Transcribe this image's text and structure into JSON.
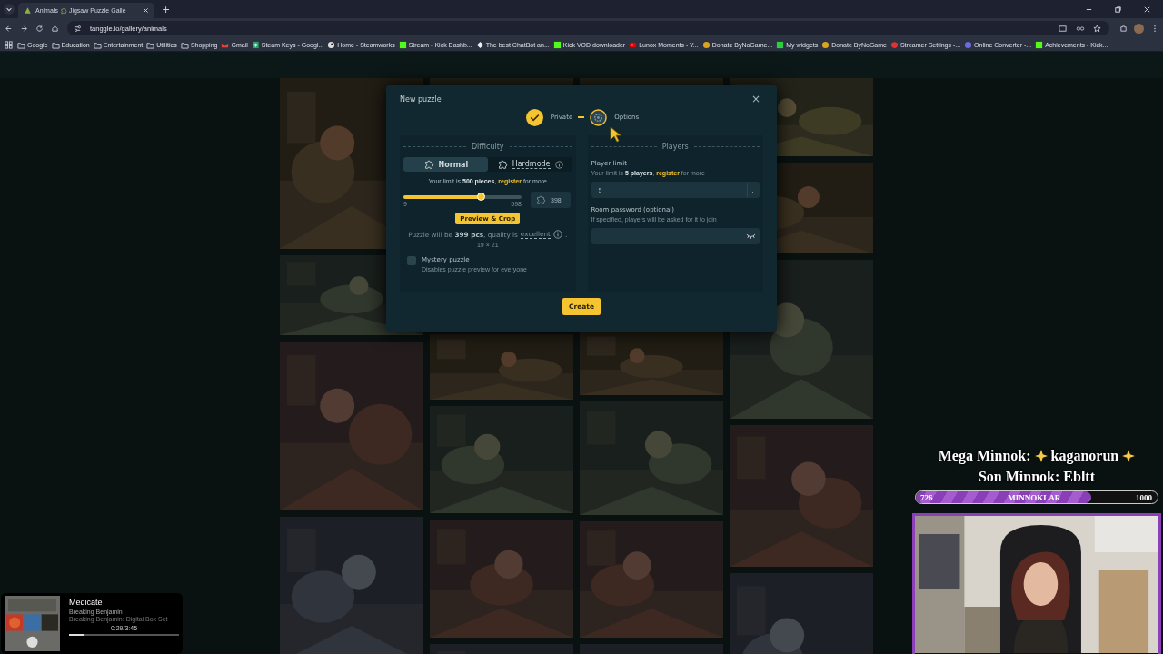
{
  "browser": {
    "tab": {
      "title_start": "Animals",
      "title_end": "Jigsaw Puzzle Galle",
      "selected": true
    },
    "new_tab": "+",
    "address": "tanggle.io/gallery/animals",
    "bookmarks": [
      {
        "label": "Google",
        "kind": "folder"
      },
      {
        "label": "Education",
        "kind": "folder"
      },
      {
        "label": "Entertainment",
        "kind": "folder"
      },
      {
        "label": "Utilities",
        "kind": "folder"
      },
      {
        "label": "Shopping",
        "kind": "folder"
      },
      {
        "label": "Gmail",
        "kind": "mail"
      },
      {
        "label": "Steam Keys - Googl...",
        "kind": "sheet"
      },
      {
        "label": "Home - Steamworks",
        "kind": "steam"
      },
      {
        "label": "Stream - Kick Dashb...",
        "kind": "kick"
      },
      {
        "label": "The best ChatBot an...",
        "kind": "diamond"
      },
      {
        "label": "Kick VOD downloader",
        "kind": "kick"
      },
      {
        "label": "Lunox Moments - Y...",
        "kind": "video"
      },
      {
        "label": "Donate ByNoGame...",
        "kind": "donate"
      },
      {
        "label": "My widgets",
        "kind": "square"
      },
      {
        "label": "Donate ByNoGame",
        "kind": "donate"
      },
      {
        "label": "Streamer Settings -...",
        "kind": "shield"
      },
      {
        "label": "Online Converter -...",
        "kind": "circle"
      },
      {
        "label": "Achievements - Kick...",
        "kind": "kick"
      }
    ]
  },
  "modal": {
    "title": "New puzzle",
    "close": "×",
    "steps": [
      {
        "label": "Private",
        "kind": "done"
      },
      {
        "label": "Options",
        "kind": "current"
      }
    ],
    "difficulty": {
      "heading": "Difficulty",
      "modes": [
        {
          "label": "Normal",
          "selected": true,
          "info": false
        },
        {
          "label": "Hardmode",
          "selected": false,
          "info": true
        }
      ],
      "limit_before": "Your limit is **500 pieces**,",
      "limit_link": "register",
      "limit_after": "for more",
      "slider": {
        "level": 0.66,
        "min": "9",
        "max": "598"
      },
      "pieces_value": "398",
      "preview_button": "Preview & Crop",
      "result_before": "Puzzle will be **399 pcs**, quality is",
      "quality": "excellent",
      "result_end": ".",
      "grid": "19 × 21",
      "mystery": {
        "label": "Mystery puzzle",
        "hint": "Disables puzzle preview for everyone",
        "checked": false
      }
    },
    "players": {
      "heading": "Players",
      "limit_label": "Player limit",
      "limit_before": "Your limit is **5 players**,",
      "limit_link": "register",
      "limit_after": "for more",
      "limit_value": "5",
      "password_label": "Room password (optional)",
      "password_hint": "If specified, players will be asked for it to join"
    },
    "create_button": "Create"
  },
  "overlay": {
    "mega_label": "Mega Minnok:",
    "mega_name": "kaganorun",
    "son": "Son Minnok: Ebltt",
    "goal": {
      "current": "726",
      "label": "MINNOKLAR",
      "target": "1000",
      "level": 0.726
    }
  },
  "music": {
    "title": "Medicate",
    "artist": "Breaking Benjamin",
    "album": "Breaking Benjamin: Digital Box Set",
    "time": "0:29/3:45",
    "level": 0.13
  }
}
